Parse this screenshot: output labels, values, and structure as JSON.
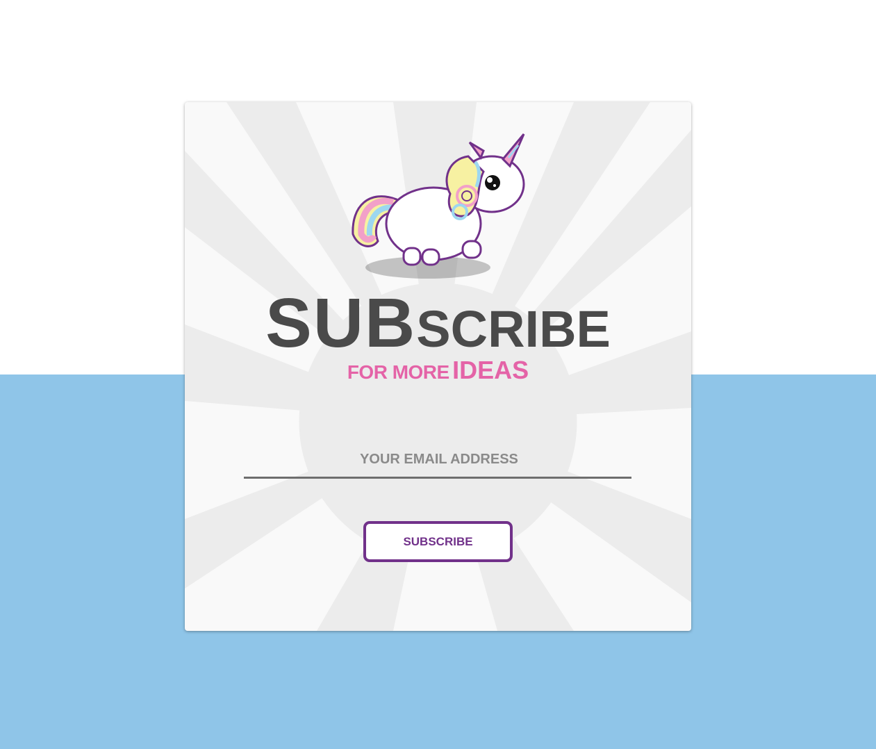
{
  "page": {
    "background_top": "#ffffff",
    "background_bottom": "#8fc5e8"
  },
  "card": {
    "headline_big": "SUB",
    "headline_small": "SCRIBE",
    "subline_part1": "FOR MORE",
    "subline_part2": "IDEAS",
    "headline_color": "#4a4a4a",
    "accent_pink": "#e463a7",
    "mascot_icon": "unicorn-icon"
  },
  "form": {
    "email_placeholder": "YOUR EMAIL ADDRESS",
    "email_value": "",
    "subscribe_label": "SUBSCRIBE",
    "button_color": "#71318a"
  }
}
